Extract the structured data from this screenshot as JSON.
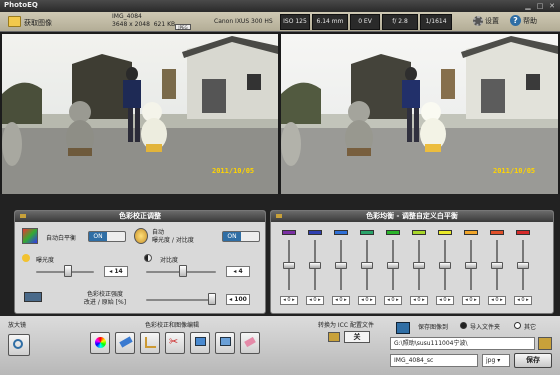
{
  "app": {
    "title": "PhotoEQ"
  },
  "toolbar": {
    "open_label": "获取图像",
    "filename": "IMG_4084",
    "dimensions": "3648 x 2048",
    "filesize": "621 KB",
    "format": "JPEG",
    "camera": "Canon IXUS 300 HS",
    "iso": "ISO 125",
    "focal": "6.14 mm",
    "ev": "0 EV",
    "aperture": "f/ 2.8",
    "shutter": "1/1614",
    "settings_label": "设置",
    "help_label": "帮助"
  },
  "photos": {
    "date_stamp": "2011/10/05"
  },
  "color_panel": {
    "title": "色彩校正调整",
    "auto_wb_label": "自动白平衡",
    "auto_wb_state": "ON",
    "auto_exposure_label": "自动\n曝光度 / 对比度",
    "auto_exposure_state": "ON",
    "exposure_label": "曝光度",
    "exposure_value": "14",
    "contrast_label": "对比度",
    "contrast_value": "4",
    "strength_label": "色彩校正强度\n改进 / 原始 [%]",
    "strength_value": "100",
    "exposure_level": 0.56,
    "contrast_level": 0.53,
    "strength_level": 1.0
  },
  "eq_panel": {
    "title": "色彩均衡 - 调整自定义白平衡",
    "channels": [
      {
        "color": "#7a2fa3",
        "value": "0",
        "level": 0.5
      },
      {
        "color": "#2f3fb0",
        "value": "0",
        "level": 0.5
      },
      {
        "color": "#2f6fd6",
        "value": "0",
        "level": 0.5
      },
      {
        "color": "#2aa36a",
        "value": "0",
        "level": 0.5
      },
      {
        "color": "#2bb52b",
        "value": "0",
        "level": 0.5
      },
      {
        "color": "#a8d62a",
        "value": "0",
        "level": 0.5
      },
      {
        "color": "#e8e82a",
        "value": "0",
        "level": 0.5
      },
      {
        "color": "#f0a52a",
        "value": "0",
        "level": 0.5
      },
      {
        "color": "#e0502a",
        "value": "0",
        "level": 0.5
      },
      {
        "color": "#d62a2a",
        "value": "0",
        "level": 0.5
      }
    ]
  },
  "bottom": {
    "zoom_label": "放大镜",
    "edit_label": "色彩校正和图像编辑",
    "icc_label": "转换为 ICC 配置文件",
    "icc_state": "关",
    "save_to_label": "保存图像到",
    "import_folder_label": "导入文件夹",
    "other_label": "其它",
    "path": "G:\\照助\\susu111004宁波\\",
    "filename": "IMG_4084_sc",
    "ext": "jpg",
    "save_label": "保存"
  }
}
